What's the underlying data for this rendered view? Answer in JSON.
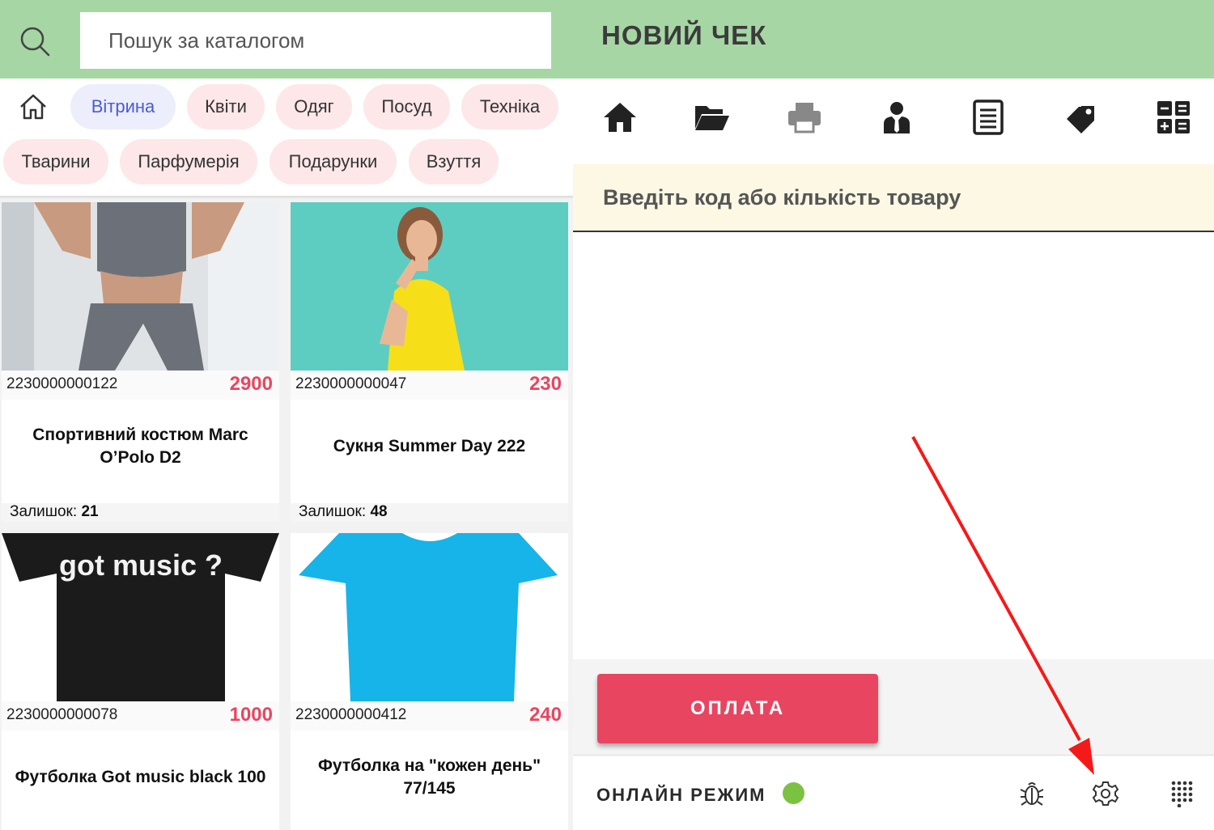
{
  "search": {
    "placeholder": "Пошук за каталогом"
  },
  "receipt": {
    "title": "НОВИЙ ЧЕК",
    "code_placeholder": "Введіть код або кількість товару"
  },
  "categories": {
    "home_icon": "home-outline-icon",
    "items": [
      {
        "label": "Вітрина",
        "active": true
      },
      {
        "label": "Квіти"
      },
      {
        "label": "Одяг"
      },
      {
        "label": "Посуд"
      },
      {
        "label": "Техніка"
      },
      {
        "label": "Тварини"
      },
      {
        "label": "Парфумерія"
      },
      {
        "label": "Подарунки"
      },
      {
        "label": "Взуття"
      }
    ]
  },
  "products": [
    {
      "code": "2230000000122",
      "price": "2900",
      "name": "Спортивний костюм Marc O’Polo D2",
      "stock_label": "Залишок:",
      "stock": "21",
      "image": "woman-sportswear-photo"
    },
    {
      "code": "2230000000047",
      "price": "230",
      "name": "Сукня Summer Day 222",
      "stock_label": "Залишок:",
      "stock": "48",
      "image": "woman-yellow-dress-photo"
    },
    {
      "code": "2230000000078",
      "price": "1000",
      "name": "Футболка Got music black 100",
      "image": "black-tshirt-photo",
      "print_text": "got music ?"
    },
    {
      "code": "2230000000412",
      "price": "240",
      "name": "Футболка на \"кожен день\" 77/145",
      "image": "blue-tshirt-photo"
    }
  ],
  "toolbar": {
    "icons": [
      "home-icon",
      "folder-open-icon",
      "printer-icon",
      "user-tie-icon",
      "document-icon",
      "tags-icon",
      "calculator-icon"
    ]
  },
  "payment": {
    "label": "ОПЛАТА"
  },
  "status": {
    "label": "ОНЛАЙН РЕЖИМ",
    "dot_color": "#7cc242"
  },
  "footer_icons": [
    "bug-icon",
    "gear-icon",
    "keypad-icon"
  ],
  "colors": {
    "header": "#a6d6a4",
    "accent": "#e84560",
    "chip": "#fde7e8",
    "chip_active": "#eceefb",
    "code_bg": "#fcf8e3"
  }
}
